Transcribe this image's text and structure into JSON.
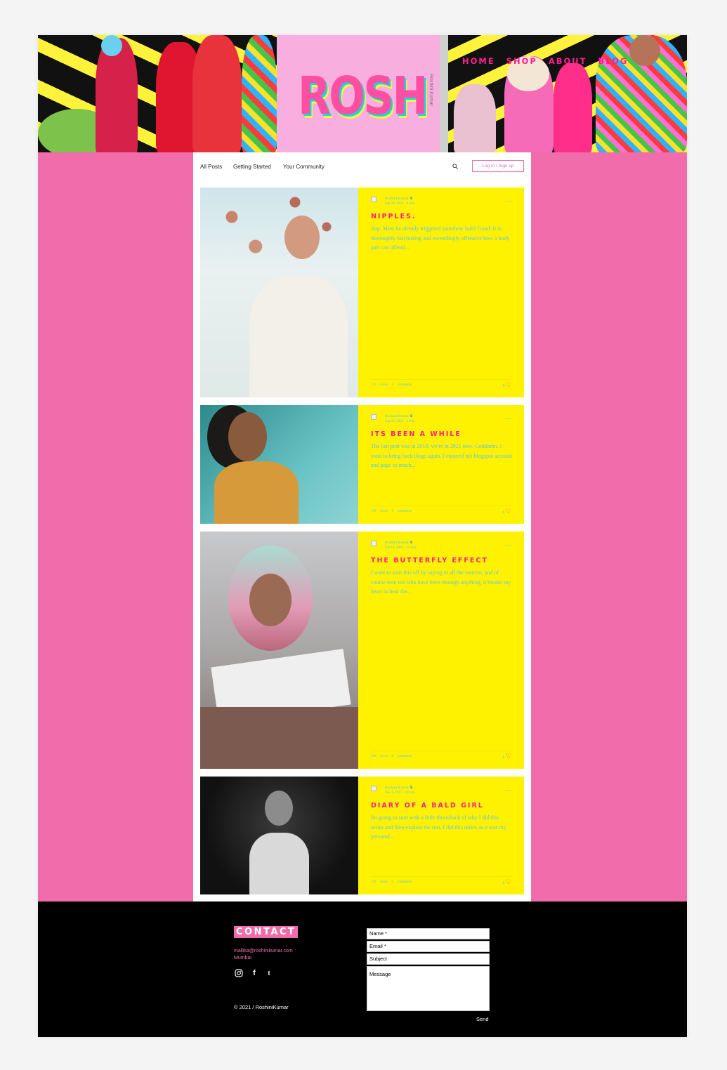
{
  "header": {
    "logo": "ROSH",
    "strip_text": "Roshini Kumar",
    "nav": [
      "HOME",
      "SHOP",
      "ABOUT",
      "BLOG"
    ]
  },
  "blog_nav": {
    "items": [
      "All Posts",
      "Getting Started",
      "Your Community"
    ],
    "login": "Log in / Sign up"
  },
  "posts": [
    {
      "author": "Roshini Kumar",
      "meta": "Apr 26, 2021 · 6 min",
      "title": "NIPPLES.",
      "excerpt": "Yup. Must be already triggered somehow huh? Good. It is thoroughly fascinating and exceedingly offensive how a body part can offend...",
      "stats": "172 views 0 comments",
      "likes": "9"
    },
    {
      "author": "Roshini Kumar",
      "meta": "Apr 25, 2021 · 3 min",
      "title": "ITS BEEN A WHILE",
      "excerpt": "The last post was in 2018, we're in 2021 now. Goddamn. I want to bring back blogs again. I enjoyed my blogspot account and page so much...",
      "stats": "159 views 0 comments",
      "likes": "4"
    },
    {
      "author": "Roshini Kumar",
      "meta": "Oct 14, 2018 · 15 min",
      "title": "THE BUTTERFLY EFFECT",
      "excerpt": "I want to start this off by saying to all the womxn, and of course men too who have been through anything, it breaks my heart to hear the...",
      "stats": "418 views 0 comments",
      "likes": "6"
    },
    {
      "author": "Roshini Kumar",
      "meta": "Dec 1, 2017 · 10 min",
      "title": "DIARY OF A BALD GIRL",
      "excerpt": "Im going to start with a little throwback of why I did this series and then explain the rest. I did this series as it was my personal...",
      "stats": "110 views 0 comments",
      "likes": "3"
    }
  ],
  "footer": {
    "contact_heading": "CONTACT",
    "email": "mallika@roshinikumar.com",
    "city": "Mumbai",
    "copyright": "© 2021 / RoshiniKumar",
    "form": {
      "name": "Name *",
      "email": "Email *",
      "subject": "Subject",
      "message": "Message",
      "send": "Send"
    }
  },
  "colors": {
    "pink": "#f06cab",
    "hot_pink": "#ff1f8f",
    "yellow": "#fff200",
    "cyan": "#5fc7e8"
  },
  "icons": [
    "search-icon",
    "instagram-icon",
    "facebook-icon",
    "tumblr-icon",
    "heart-icon",
    "more-options-icon",
    "crown-icon"
  ]
}
